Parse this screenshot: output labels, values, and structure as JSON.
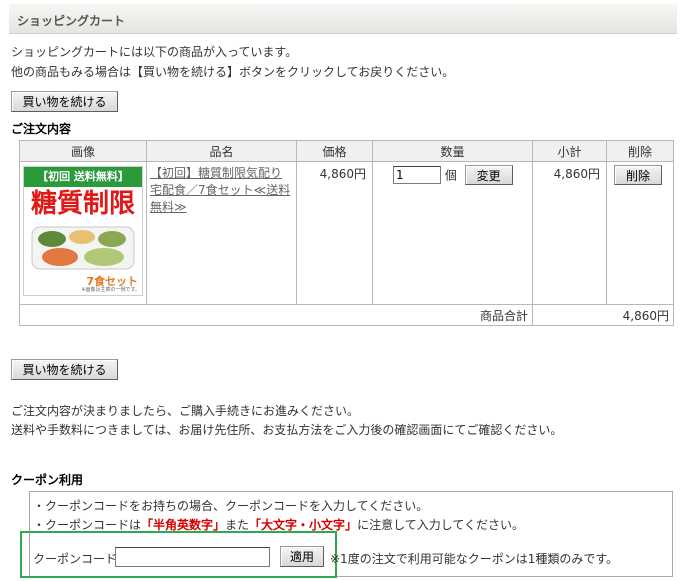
{
  "header": {
    "title": "ショッピングカート"
  },
  "intro": {
    "line1": "ショッピングカートには以下の商品が入っています。",
    "line2": "他の商品もみる場合は【買い物を続ける】ボタンをクリックしてお戻りください。"
  },
  "buttons": {
    "continue_shopping": "買い物を続ける",
    "change": "変更",
    "delete": "削除",
    "apply": "適用"
  },
  "order": {
    "title": "ご注文内容",
    "columns": [
      "画像",
      "品名",
      "価格",
      "数量",
      "小計",
      "削除"
    ],
    "items": [
      {
        "image_texts": {
          "banner": "【初回 送料無料】",
          "headline": "糖質制限",
          "set": "7食セット",
          "note": "※画像は主菜の一例です。"
        },
        "name": "【初回】糖質制限気配り宅配食／7食セット≪送料無料≫",
        "price": "4,860円",
        "quantity": "1",
        "unit": "個",
        "subtotal": "4,860円"
      }
    ],
    "total_label": "商品合計",
    "total_value": "4,860円"
  },
  "checkout_note": {
    "line1": "ご注文内容が決まりましたら、ご購入手続きにお進みください。",
    "line2": "送料や手数料につきましては、お届け先住所、お支払方法をご入力後の確認画面にてご確認ください。"
  },
  "coupon": {
    "title": "クーポン利用",
    "note1": "・クーポンコードをお持ちの場合、クーポンコードを入力してください。",
    "note2_pre": "・クーポンコードは",
    "note2_red1": "「半角英数字」",
    "note2_mid": "また",
    "note2_red2": "「大文字・小文字」",
    "note2_post": "に注意して入力してください。",
    "label": "クーポンコード",
    "input_value": "",
    "note3": "※1度の注文で利用可能なクーポンは1種類のみです。"
  },
  "colors": {
    "highlight": "#2eaa4f",
    "warning_red": "#d40000",
    "banner_green": "#2a9a3a",
    "headline_red": "#e01818"
  }
}
